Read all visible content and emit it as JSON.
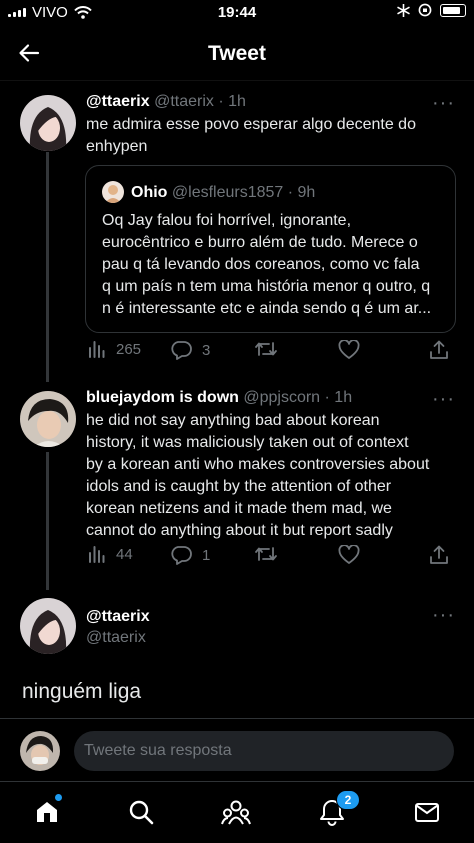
{
  "status_bar": {
    "carrier": "VIVO",
    "time": "19:44"
  },
  "header": {
    "title": "Tweet"
  },
  "tweet1": {
    "name": "@ttaerix",
    "meta": "@ttaerix · 1h",
    "text_lines": [
      "me admira esse povo esperar algo decente do",
      "enhypen"
    ],
    "quote": {
      "name": "Ohio",
      "meta": "@lesfleurs1857 · 9h",
      "text_lines": [
        "Oq Jay falou foi horrível, ignorante,",
        "eurocêntrico e burro além de tudo. Merece o",
        "pau q tá levando dos coreanos, como vc fala",
        "q um país n tem uma história menor q outro, q",
        "n é interessante etc e ainda sendo q é um ar..."
      ]
    },
    "actions": {
      "views": "265",
      "replies": "3",
      "retweets": "",
      "likes": ""
    }
  },
  "tweet2": {
    "name": "bluejaydom is down",
    "meta": "@ppjscorn · 1h",
    "text_lines": [
      "he did not say anything bad about korean",
      "history, it was maliciously taken out of context",
      "by a korean anti who makes controversies about",
      "idols and is caught by the attention of other",
      "korean netizens and it made them mad, we",
      "cannot do anything about it but report sadly"
    ],
    "actions": {
      "views": "44",
      "replies": "1",
      "retweets": "",
      "likes": ""
    }
  },
  "main_tweet": {
    "name": "@ttaerix",
    "handle": "@ttaerix",
    "text": "ninguém liga"
  },
  "compose": {
    "placeholder": "Tweete sua resposta"
  },
  "tabbar": {
    "notifications_badge": "2"
  },
  "colors": {
    "accent": "#1d9bf0",
    "background": "#000000",
    "muted": "#71767b"
  }
}
